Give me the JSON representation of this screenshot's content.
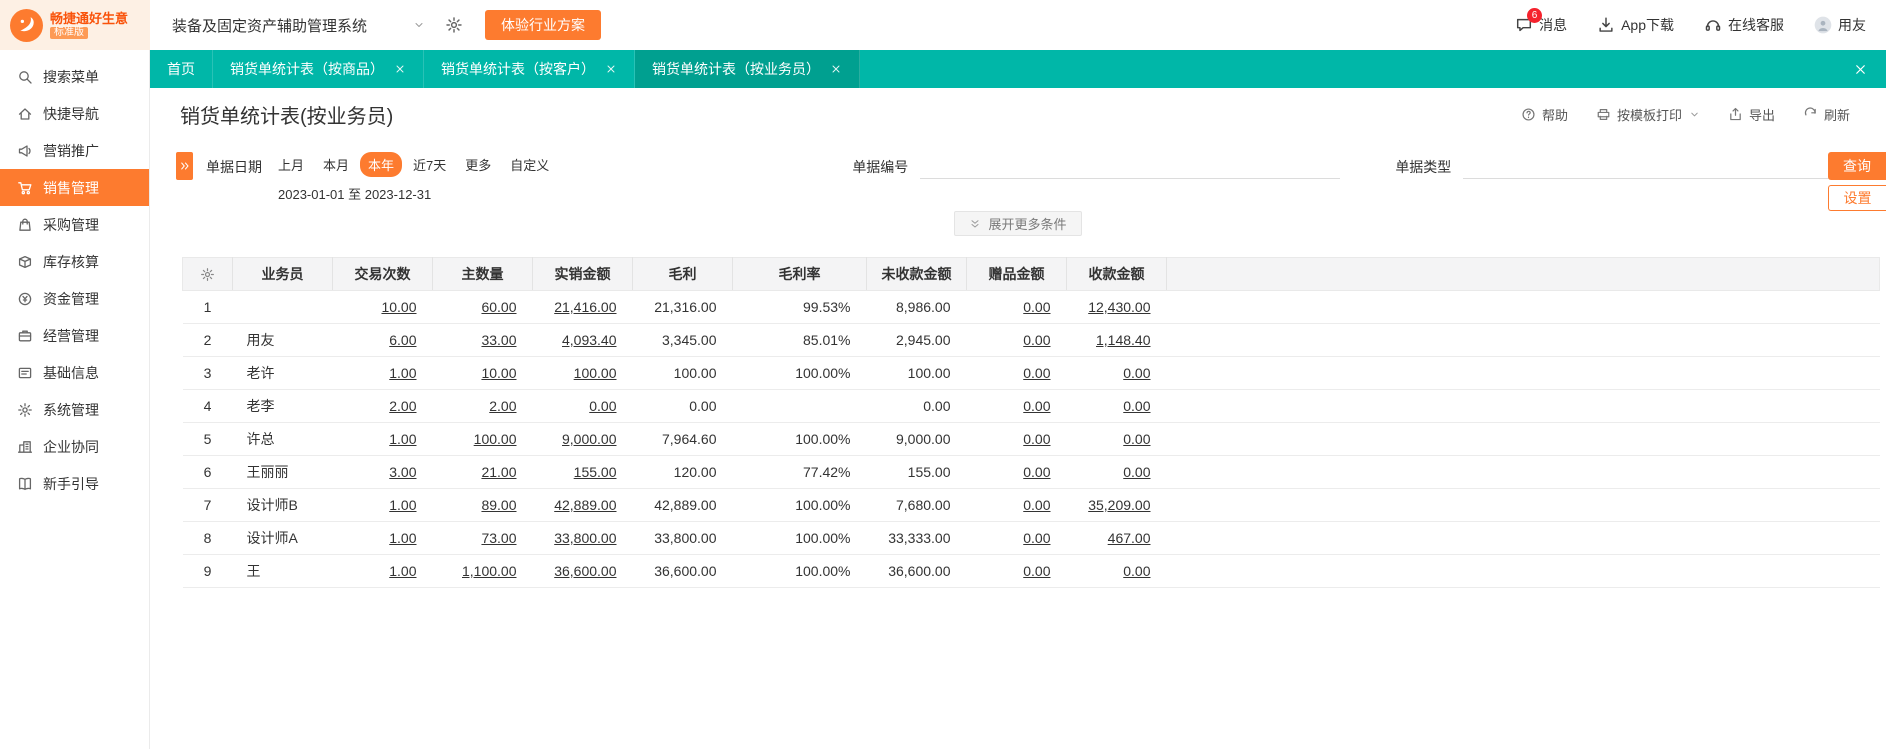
{
  "colors": {
    "accent_orange": "#fd7b2f",
    "teal": "#00b7a8",
    "teal_active_tab": "#00a090",
    "badge_red": "#f5222d"
  },
  "topbar": {
    "logo_title": "畅捷通好生意",
    "logo_badge": "标准版",
    "system_select": "装备及固定资产辅助管理系统",
    "trial_button": "体验行业方案",
    "actions": [
      {
        "name": "messages",
        "label": "消息",
        "icon": "message-icon",
        "badge": "6"
      },
      {
        "name": "app-download",
        "label": "App下载",
        "icon": "download-icon"
      },
      {
        "name": "online-service",
        "label": "在线客服",
        "icon": "headset-icon"
      },
      {
        "name": "user",
        "label": "用友",
        "icon": "avatar-icon"
      }
    ]
  },
  "sidebar": {
    "items": [
      {
        "name": "search-menu",
        "label": "搜索菜单",
        "icon": "search-icon",
        "active": false
      },
      {
        "name": "quick-nav",
        "label": "快捷导航",
        "icon": "home-icon",
        "active": false
      },
      {
        "name": "marketing",
        "label": "营销推广",
        "icon": "megaphone-icon",
        "active": false
      },
      {
        "name": "sales",
        "label": "销售管理",
        "icon": "cart-icon",
        "active": true
      },
      {
        "name": "purchase",
        "label": "采购管理",
        "icon": "bag-icon",
        "active": false
      },
      {
        "name": "inventory",
        "label": "库存核算",
        "icon": "box-icon",
        "active": false
      },
      {
        "name": "funds",
        "label": "资金管理",
        "icon": "coin-icon",
        "active": false
      },
      {
        "name": "operations",
        "label": "经营管理",
        "icon": "briefcase-icon",
        "active": false
      },
      {
        "name": "base-info",
        "label": "基础信息",
        "icon": "card-icon",
        "active": false
      },
      {
        "name": "system",
        "label": "系统管理",
        "icon": "gear-icon",
        "active": false
      },
      {
        "name": "collaboration",
        "label": "企业协同",
        "icon": "building-icon",
        "active": false
      },
      {
        "name": "guide",
        "label": "新手引导",
        "icon": "book-icon",
        "active": false
      }
    ]
  },
  "tabs": {
    "items": [
      {
        "name": "home",
        "label": "首页",
        "closable": false,
        "active": false
      },
      {
        "name": "report-by-product",
        "label": "销货单统计表（按商品）",
        "closable": true,
        "active": false
      },
      {
        "name": "report-by-customer",
        "label": "销货单统计表（按客户）",
        "closable": true,
        "active": false
      },
      {
        "name": "report-by-salesperson",
        "label": "销货单统计表（按业务员）",
        "closable": true,
        "active": true
      }
    ]
  },
  "page": {
    "title": "销货单统计表(按业务员)",
    "toolbar": [
      {
        "name": "help",
        "label": "帮助",
        "icon": "help-icon",
        "dropdown": false
      },
      {
        "name": "print-by-template",
        "label": "按模板打印",
        "icon": "printer-icon",
        "dropdown": true
      },
      {
        "name": "export",
        "label": "导出",
        "icon": "export-icon",
        "dropdown": false
      },
      {
        "name": "refresh",
        "label": "刷新",
        "icon": "refresh-icon",
        "dropdown": false
      }
    ]
  },
  "filters": {
    "date_label": "单据日期",
    "quick_options": [
      {
        "name": "last-month",
        "label": "上月",
        "selected": false
      },
      {
        "name": "this-month",
        "label": "本月",
        "selected": false
      },
      {
        "name": "this-year",
        "label": "本年",
        "selected": true
      },
      {
        "name": "last-7-days",
        "label": "近7天",
        "selected": false
      },
      {
        "name": "more",
        "label": "更多",
        "selected": false
      },
      {
        "name": "custom",
        "label": "自定义",
        "selected": false
      }
    ],
    "date_from": "2023-01-01",
    "date_separator": "至",
    "date_to": "2023-12-31",
    "doc_no_label": "单据编号",
    "doc_no_value": "",
    "doc_type_label": "单据类型",
    "doc_type_value": "",
    "search_button": "查询",
    "settings_button": "设置",
    "expand_more": "展开更多条件"
  },
  "table": {
    "columns": [
      "业务员",
      "交易次数",
      "主数量",
      "实销金额",
      "毛利",
      "毛利率",
      "未收款金额",
      "赠品金额",
      "收款金额"
    ],
    "link_columns": [
      1,
      2,
      3,
      7,
      8
    ],
    "rows": [
      {
        "no": "1",
        "cells": [
          "",
          "10.00",
          "60.00",
          "21,416.00",
          "21,316.00",
          "99.53%",
          "8,986.00",
          "0.00",
          "12,430.00"
        ]
      },
      {
        "no": "2",
        "cells": [
          "用友",
          "6.00",
          "33.00",
          "4,093.40",
          "3,345.00",
          "85.01%",
          "2,945.00",
          "0.00",
          "1,148.40"
        ]
      },
      {
        "no": "3",
        "cells": [
          "老许",
          "1.00",
          "10.00",
          "100.00",
          "100.00",
          "100.00%",
          "100.00",
          "0.00",
          "0.00"
        ]
      },
      {
        "no": "4",
        "cells": [
          "老李",
          "2.00",
          "2.00",
          "0.00",
          "0.00",
          "",
          "0.00",
          "0.00",
          "0.00"
        ]
      },
      {
        "no": "5",
        "cells": [
          "许总",
          "1.00",
          "100.00",
          "9,000.00",
          "7,964.60",
          "100.00%",
          "9,000.00",
          "0.00",
          "0.00"
        ]
      },
      {
        "no": "6",
        "cells": [
          "王丽丽",
          "3.00",
          "21.00",
          "155.00",
          "120.00",
          "77.42%",
          "155.00",
          "0.00",
          "0.00"
        ]
      },
      {
        "no": "7",
        "cells": [
          "设计师B",
          "1.00",
          "89.00",
          "42,889.00",
          "42,889.00",
          "100.00%",
          "7,680.00",
          "0.00",
          "35,209.00"
        ]
      },
      {
        "no": "8",
        "cells": [
          "设计师A",
          "1.00",
          "73.00",
          "33,800.00",
          "33,800.00",
          "100.00%",
          "33,333.00",
          "0.00",
          "467.00"
        ]
      },
      {
        "no": "9",
        "cells": [
          "王",
          "1.00",
          "1,100.00",
          "36,600.00",
          "36,600.00",
          "100.00%",
          "36,600.00",
          "0.00",
          "0.00"
        ]
      }
    ]
  }
}
